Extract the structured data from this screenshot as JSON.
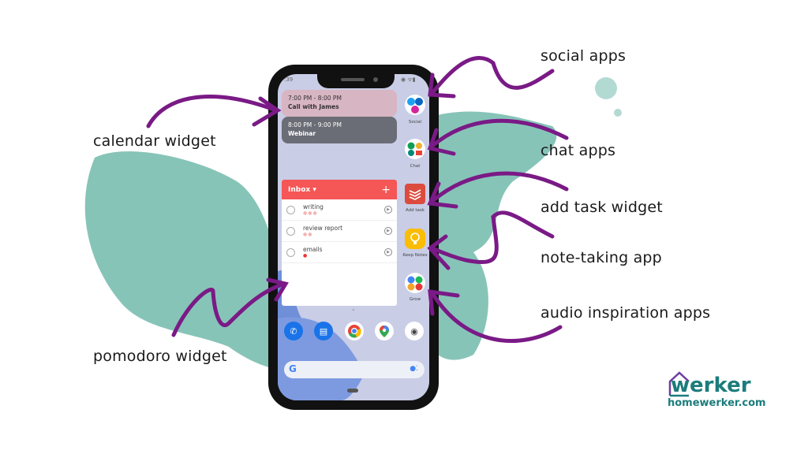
{
  "annotations": {
    "calendar_widget": "calendar widget",
    "pomodoro_widget": "pomodoro widget",
    "social_apps": "social apps",
    "chat_apps": "chat apps",
    "add_task_widget": "add task widget",
    "note_taking_app": "note-taking app",
    "audio_inspiration_apps": "audio inspiration apps"
  },
  "phone": {
    "status_time": ":39",
    "calendar_events": [
      {
        "time": "7:00 PM - 8:00 PM",
        "title": "Call with James"
      },
      {
        "time": "8:00 PM - 9:00 PM",
        "title": "Webinar"
      }
    ],
    "todo": {
      "header": "Inbox",
      "dropdown_glyph": "▾",
      "add_glyph": "+",
      "items": [
        {
          "name": "writing",
          "dots": "●●●"
        },
        {
          "name": "review report",
          "dots": "●●"
        },
        {
          "name": "emails",
          "dots": "●"
        }
      ]
    },
    "side_apps": [
      {
        "label": "Social"
      },
      {
        "label": "Chat"
      },
      {
        "label": "Add task"
      },
      {
        "label": "Keep Notes"
      },
      {
        "label": "Grow"
      }
    ],
    "dock": [
      {
        "name": "phone"
      },
      {
        "name": "messages"
      },
      {
        "name": "chrome"
      },
      {
        "name": "maps"
      },
      {
        "name": "camera"
      }
    ]
  },
  "brand": {
    "logo_word": "werker",
    "url": "homewerker.com",
    "teal": "#1c7c7c",
    "purple": "#7a1a86"
  }
}
